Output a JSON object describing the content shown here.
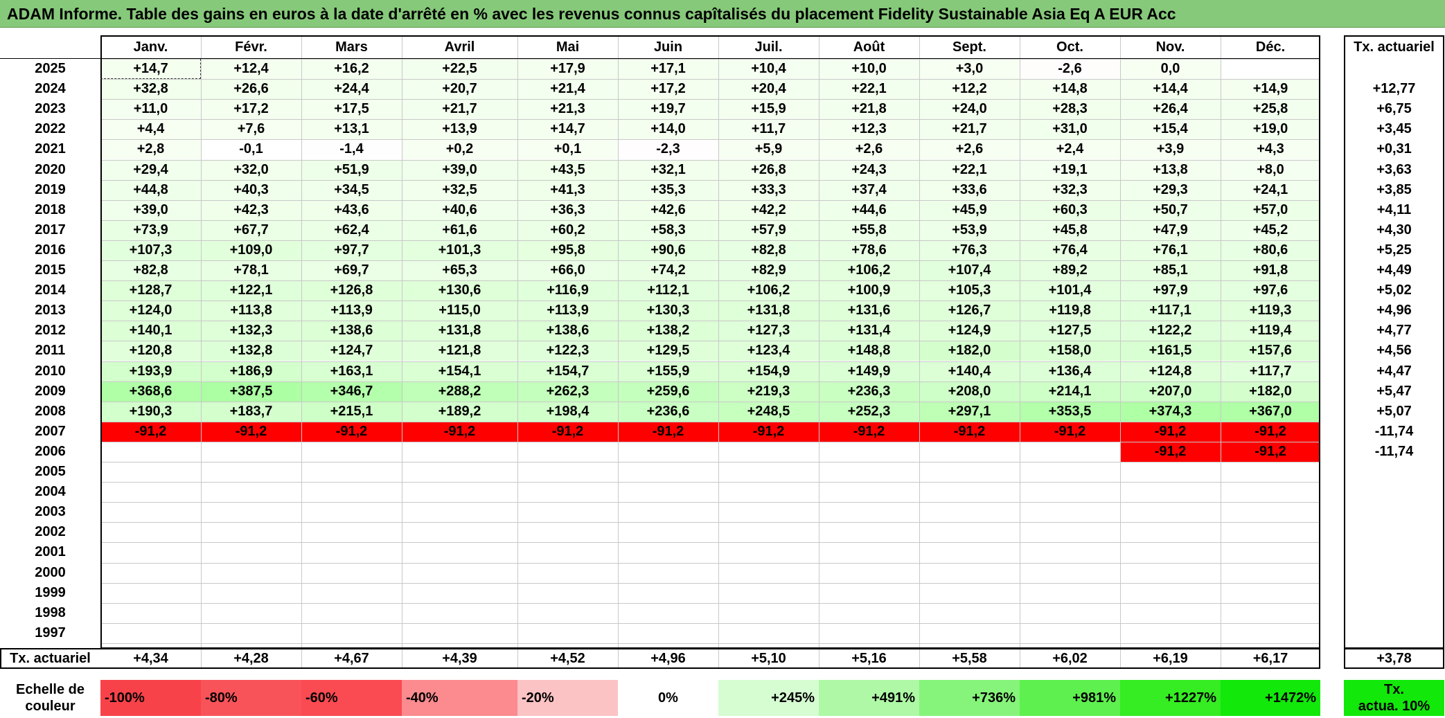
{
  "title": "ADAM Informe. Table des gains en euros à la date d'arrêté en % avec les revenus connus capîtalisés du placement Fidelity Sustainable Asia Eq A EUR Acc",
  "months": [
    "Janv.",
    "Févr.",
    "Mars",
    "Avril",
    "Mai",
    "Juin",
    "Juil.",
    "Août",
    "Sept.",
    "Oct.",
    "Nov.",
    "Déc."
  ],
  "rate_header": "Tx. actuariel",
  "rows": [
    {
      "year": "2025",
      "values": [
        "+14,7",
        "+12,4",
        "+16,2",
        "+22,5",
        "+17,9",
        "+17,1",
        "+10,4",
        "+10,0",
        "+3,0",
        "-2,6",
        "0,0",
        ""
      ],
      "rate": ""
    },
    {
      "year": "2024",
      "values": [
        "+32,8",
        "+26,6",
        "+24,4",
        "+20,7",
        "+21,4",
        "+17,2",
        "+20,4",
        "+22,1",
        "+12,2",
        "+14,8",
        "+14,4",
        "+14,9"
      ],
      "rate": "+12,77"
    },
    {
      "year": "2023",
      "values": [
        "+11,0",
        "+17,2",
        "+17,5",
        "+21,7",
        "+21,3",
        "+19,7",
        "+15,9",
        "+21,8",
        "+24,0",
        "+28,3",
        "+26,4",
        "+25,8"
      ],
      "rate": "+6,75"
    },
    {
      "year": "2022",
      "values": [
        "+4,4",
        "+7,6",
        "+13,1",
        "+13,9",
        "+14,7",
        "+14,0",
        "+11,7",
        "+12,3",
        "+21,7",
        "+31,0",
        "+15,4",
        "+19,0"
      ],
      "rate": "+3,45"
    },
    {
      "year": "2021",
      "values": [
        "+2,8",
        "-0,1",
        "-1,4",
        "+0,2",
        "+0,1",
        "-2,3",
        "+5,9",
        "+2,6",
        "+2,6",
        "+2,4",
        "+3,9",
        "+4,3"
      ],
      "rate": "+0,31"
    },
    {
      "year": "2020",
      "values": [
        "+29,4",
        "+32,0",
        "+51,9",
        "+39,0",
        "+43,5",
        "+32,1",
        "+26,8",
        "+24,3",
        "+22,1",
        "+19,1",
        "+13,8",
        "+8,0"
      ],
      "rate": "+3,63"
    },
    {
      "year": "2019",
      "values": [
        "+44,8",
        "+40,3",
        "+34,5",
        "+32,5",
        "+41,3",
        "+35,3",
        "+33,3",
        "+37,4",
        "+33,6",
        "+32,3",
        "+29,3",
        "+24,1"
      ],
      "rate": "+3,85"
    },
    {
      "year": "2018",
      "values": [
        "+39,0",
        "+42,3",
        "+43,6",
        "+40,6",
        "+36,3",
        "+42,6",
        "+42,2",
        "+44,6",
        "+45,9",
        "+60,3",
        "+50,7",
        "+57,0"
      ],
      "rate": "+4,11"
    },
    {
      "year": "2017",
      "values": [
        "+73,9",
        "+67,7",
        "+62,4",
        "+61,6",
        "+60,2",
        "+58,3",
        "+57,9",
        "+55,8",
        "+53,9",
        "+45,8",
        "+47,9",
        "+45,2"
      ],
      "rate": "+4,30"
    },
    {
      "year": "2016",
      "values": [
        "+107,3",
        "+109,0",
        "+97,7",
        "+101,3",
        "+95,8",
        "+90,6",
        "+82,8",
        "+78,6",
        "+76,3",
        "+76,4",
        "+76,1",
        "+80,6"
      ],
      "rate": "+5,25"
    },
    {
      "year": "2015",
      "values": [
        "+82,8",
        "+78,1",
        "+69,7",
        "+65,3",
        "+66,0",
        "+74,2",
        "+82,9",
        "+106,2",
        "+107,4",
        "+89,2",
        "+85,1",
        "+91,8"
      ],
      "rate": "+4,49"
    },
    {
      "year": "2014",
      "values": [
        "+128,7",
        "+122,1",
        "+126,8",
        "+130,6",
        "+116,9",
        "+112,1",
        "+106,2",
        "+100,9",
        "+105,3",
        "+101,4",
        "+97,9",
        "+97,6"
      ],
      "rate": "+5,02"
    },
    {
      "year": "2013",
      "values": [
        "+124,0",
        "+113,8",
        "+113,9",
        "+115,0",
        "+113,9",
        "+130,3",
        "+131,8",
        "+131,6",
        "+126,7",
        "+119,8",
        "+117,1",
        "+119,3"
      ],
      "rate": "+4,96"
    },
    {
      "year": "2012",
      "values": [
        "+140,1",
        "+132,3",
        "+138,6",
        "+131,8",
        "+138,6",
        "+138,2",
        "+127,3",
        "+131,4",
        "+124,9",
        "+127,5",
        "+122,2",
        "+119,4"
      ],
      "rate": "+4,77"
    },
    {
      "year": "2011",
      "values": [
        "+120,8",
        "+132,8",
        "+124,7",
        "+121,8",
        "+122,3",
        "+129,5",
        "+123,4",
        "+148,8",
        "+182,0",
        "+158,0",
        "+161,5",
        "+157,6"
      ],
      "rate": "+4,56"
    },
    {
      "year": "2010",
      "values": [
        "+193,9",
        "+186,9",
        "+163,1",
        "+154,1",
        "+154,7",
        "+155,9",
        "+154,9",
        "+149,9",
        "+140,4",
        "+136,4",
        "+124,8",
        "+117,7"
      ],
      "rate": "+4,47"
    },
    {
      "year": "2009",
      "values": [
        "+368,6",
        "+387,5",
        "+346,7",
        "+288,2",
        "+262,3",
        "+259,6",
        "+219,3",
        "+236,3",
        "+208,0",
        "+214,1",
        "+207,0",
        "+182,0"
      ],
      "rate": "+5,47"
    },
    {
      "year": "2008",
      "values": [
        "+190,3",
        "+183,7",
        "+215,1",
        "+189,2",
        "+198,4",
        "+236,6",
        "+248,5",
        "+252,3",
        "+297,1",
        "+353,5",
        "+374,3",
        "+367,0"
      ],
      "rate": "+5,07"
    },
    {
      "year": "2007",
      "values": [
        "-91,2",
        "-91,2",
        "-91,2",
        "-91,2",
        "-91,2",
        "-91,2",
        "-91,2",
        "-91,2",
        "-91,2",
        "-91,2",
        "-91,2",
        "-91,2"
      ],
      "rate": "-11,74"
    },
    {
      "year": "2006",
      "values": [
        "",
        "",
        "",
        "",
        "",
        "",
        "",
        "",
        "",
        "",
        "-91,2",
        "-91,2"
      ],
      "rate": "-11,74"
    },
    {
      "year": "2005",
      "values": [
        "",
        "",
        "",
        "",
        "",
        "",
        "",
        "",
        "",
        "",
        "",
        ""
      ],
      "rate": ""
    },
    {
      "year": "2004",
      "values": [
        "",
        "",
        "",
        "",
        "",
        "",
        "",
        "",
        "",
        "",
        "",
        ""
      ],
      "rate": ""
    },
    {
      "year": "2003",
      "values": [
        "",
        "",
        "",
        "",
        "",
        "",
        "",
        "",
        "",
        "",
        "",
        ""
      ],
      "rate": ""
    },
    {
      "year": "2002",
      "values": [
        "",
        "",
        "",
        "",
        "",
        "",
        "",
        "",
        "",
        "",
        "",
        ""
      ],
      "rate": ""
    },
    {
      "year": "2001",
      "values": [
        "",
        "",
        "",
        "",
        "",
        "",
        "",
        "",
        "",
        "",
        "",
        ""
      ],
      "rate": ""
    },
    {
      "year": "2000",
      "values": [
        "",
        "",
        "",
        "",
        "",
        "",
        "",
        "",
        "",
        "",
        "",
        ""
      ],
      "rate": ""
    },
    {
      "year": "1999",
      "values": [
        "",
        "",
        "",
        "",
        "",
        "",
        "",
        "",
        "",
        "",
        "",
        ""
      ],
      "rate": ""
    },
    {
      "year": "1998",
      "values": [
        "",
        "",
        "",
        "",
        "",
        "",
        "",
        "",
        "",
        "",
        "",
        ""
      ],
      "rate": ""
    },
    {
      "year": "1997",
      "values": [
        "",
        "",
        "",
        "",
        "",
        "",
        "",
        "",
        "",
        "",
        "",
        ""
      ],
      "rate": ""
    }
  ],
  "footer": {
    "label": "Tx. actuariel",
    "values": [
      "+4,34",
      "+4,28",
      "+4,67",
      "+4,39",
      "+4,52",
      "+4,96",
      "+5,10",
      "+5,16",
      "+5,58",
      "+6,02",
      "+6,19",
      "+6,17"
    ],
    "rate": "+3,78"
  },
  "legend": {
    "label_line1": "Echelle de",
    "label_line2": "couleur",
    "items": [
      {
        "text": "-100%",
        "color": "#f8424a"
      },
      {
        "text": "-80%",
        "color": "#f9535a"
      },
      {
        "text": "-60%",
        "color": "#fa4a52"
      },
      {
        "text": "-40%",
        "color": "#fb8b8f"
      },
      {
        "text": "-20%",
        "color": "#fcc3c5"
      },
      {
        "text": "0%",
        "color": "#ffffff"
      },
      {
        "text": "+245%",
        "color": "#d6fcd2"
      },
      {
        "text": "+491%",
        "color": "#aef8a6"
      },
      {
        "text": "+736%",
        "color": "#86f47a"
      },
      {
        "text": "+981%",
        "color": "#5ef04e"
      },
      {
        "text": "+1227%",
        "color": "#36ec22"
      },
      {
        "text": "+1472%",
        "color": "#12e80a"
      }
    ],
    "rate_line1": "Tx.",
    "rate_line2": "actua. 10%",
    "rate_color": "#12e80a"
  },
  "colors": {
    "negative_full": "#ff0000",
    "title_bg": "#86c97a"
  }
}
